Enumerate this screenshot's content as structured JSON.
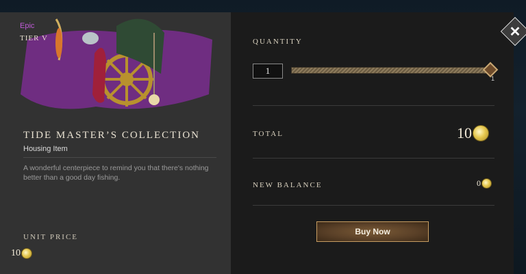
{
  "item": {
    "rarity": "Epic",
    "tier": "TIER V",
    "title": "TIDE MASTER’S COLLECTION",
    "type": "Housing Item",
    "description": "A wonderful centerpiece to remind you that there's nothing better than a good day fishing."
  },
  "unit_price": {
    "label": "UNIT PRICE",
    "value": "10"
  },
  "quantity": {
    "label": "QUANTITY",
    "value": "1",
    "max_label": "1",
    "slider_fraction": 1.0
  },
  "total": {
    "label": "TOTAL",
    "value": "10"
  },
  "new_balance": {
    "label": "NEW BALANCE",
    "value": "0"
  },
  "buy_button": {
    "label": "Buy Now"
  },
  "colors": {
    "rarity": "#c05bd8",
    "accent": "#c79d62",
    "coin": "#e6c850"
  },
  "icons": {
    "currency": "gold-coin-icon",
    "close": "close-icon"
  }
}
